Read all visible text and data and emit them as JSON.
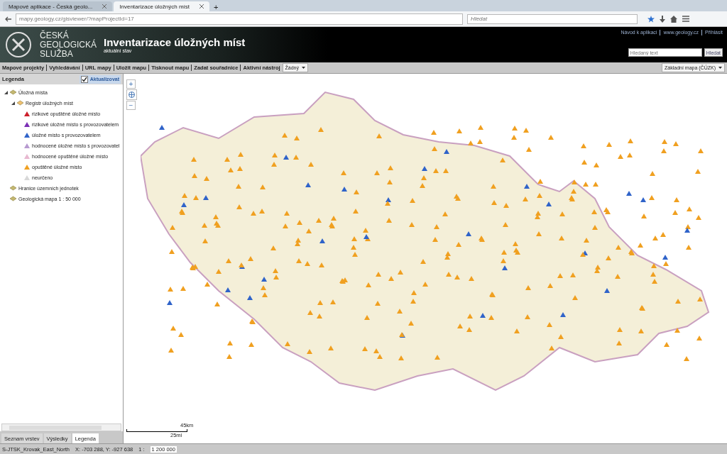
{
  "browser": {
    "tabs": [
      {
        "label": "Mapové aplikace - Česká geolo...",
        "selected": false
      },
      {
        "label": "Inventarizace úložných míst",
        "selected": true
      }
    ],
    "new_tab": "+",
    "url": "mapy.geology.cz/gisviewer/?mapProjectId=17",
    "search": {
      "placeholder": "Hledat"
    }
  },
  "header": {
    "org": [
      "ČESKÁ",
      "GEOLOGICKÁ",
      "SLUŽBA"
    ],
    "title": "Inventarizace úložných míst",
    "subtitle": "aktuální stav",
    "links": [
      "Návod k aplikaci",
      "www.geology.cz",
      "Přihlásit"
    ],
    "search": {
      "placeholder": "Hledaný text"
    },
    "search_button": "Hledat"
  },
  "toolbar": {
    "items": [
      "Mapové projekty",
      "Vyhledávání",
      "URL mapy",
      "Uložit mapu",
      "Tisknout mapu",
      "Zadat souřadnice",
      "Aktivní nástroj"
    ],
    "tool_select": "Žádný",
    "basemap_select": "Základní mapa (ČÚZK)"
  },
  "legend": {
    "title": "Legenda",
    "refresh": {
      "label": "Aktualizovat",
      "checked": true
    },
    "tree": [
      {
        "kind": "layer",
        "label": "Úložná místa",
        "expanded": true,
        "children": [
          {
            "kind": "layer",
            "label": "Registr úložných míst",
            "expanded": true,
            "children": [
              {
                "kind": "symbol",
                "label": "rizikové opuštěné úložné místo",
                "color": "#cc1f2b"
              },
              {
                "kind": "symbol",
                "label": "rizikové úložné místo s provozovatelem",
                "color": "#7b2fb5"
              },
              {
                "kind": "symbol",
                "label": "úložné místo s provozovatelem",
                "color": "#2f63c9"
              },
              {
                "kind": "symbol",
                "label": "hodnocené úložné místo s provozovatel",
                "color": "#b79ad0"
              },
              {
                "kind": "symbol",
                "label": "hodnocené opuštěné úložné místo",
                "color": "#e8b8d0"
              },
              {
                "kind": "symbol",
                "label": "opuštěné úložné místo",
                "color": "#f0a020"
              },
              {
                "kind": "symbol",
                "label": "neurčeno",
                "color": "#d8d8d8"
              }
            ]
          }
        ]
      },
      {
        "kind": "layer",
        "label": "Hranice územních jednotek"
      },
      {
        "kind": "layer",
        "label": "Geologická mapa 1 : 50 000"
      }
    ]
  },
  "panel_tabs": [
    {
      "label": "Seznam vrstev",
      "selected": false
    },
    {
      "label": "Výsledky",
      "selected": false
    },
    {
      "label": "Legenda",
      "selected": true
    }
  ],
  "map": {
    "zoom_in": "+",
    "zoom_out": "−",
    "scale_km": "45km",
    "scale_mi": "25mi"
  },
  "status_bar": {
    "projection": "S-JTSK_Krovak_East_North",
    "coords": "X: -703 288, Y: -927 638",
    "scale_label": "1 :",
    "scale_value": "1 200 000"
  }
}
